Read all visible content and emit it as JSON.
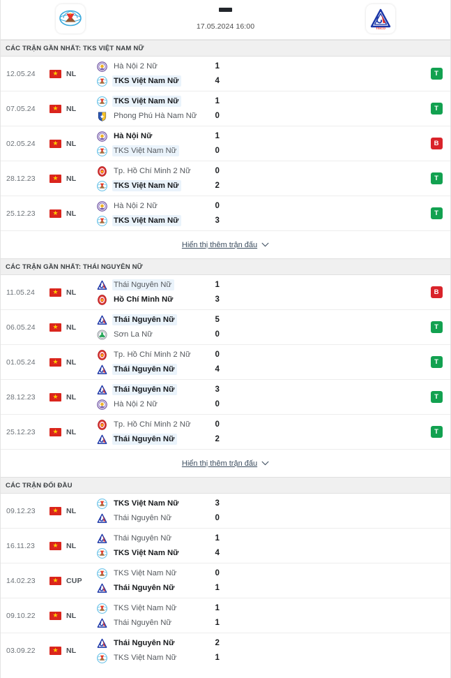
{
  "header": {
    "home_team": "TKS Việt Nam Nữ",
    "away_team": "Thái Nguyên Nữ",
    "home_logo": "vff-crest-icon",
    "away_logo": "tisco-triangle-icon",
    "score_separator": "-",
    "kickoff": "17.05.2024 16:00"
  },
  "colors": {
    "win": "#12a150",
    "loss": "#d9232a",
    "highlight": "#eaf3fb",
    "section_bg": "#f0f0f0",
    "flag_red": "#da251d",
    "flag_star": "#ffcd00"
  },
  "sections": [
    {
      "title": "CÁC TRẬN GẦN NHẤT: TKS VIỆT NAM NỮ",
      "show_more_label": "Hiển thị thêm trận đấu",
      "has_show_more": true,
      "matches": [
        {
          "date": "12.05.24",
          "competition": "NL",
          "flag": "vietnam-flag-icon",
          "home": {
            "name": "Hà Nội 2 Nữ",
            "logo": "ha-noi-crest-icon",
            "bold": false,
            "highlight": false,
            "score": "1"
          },
          "away": {
            "name": "TKS Việt Nam Nữ",
            "logo": "tks-crest-icon",
            "bold": true,
            "highlight": true,
            "score": "4"
          },
          "result": "T",
          "result_type": "win"
        },
        {
          "date": "07.05.24",
          "competition": "NL",
          "flag": "vietnam-flag-icon",
          "home": {
            "name": "TKS Việt Nam Nữ",
            "logo": "tks-crest-icon",
            "bold": true,
            "highlight": true,
            "score": "1"
          },
          "away": {
            "name": "Phong Phú Hà Nam Nữ",
            "logo": "phong-phu-ha-nam-crest-icon",
            "bold": false,
            "highlight": false,
            "score": "0"
          },
          "result": "T",
          "result_type": "win"
        },
        {
          "date": "02.05.24",
          "competition": "NL",
          "flag": "vietnam-flag-icon",
          "home": {
            "name": "Hà Nội Nữ",
            "logo": "ha-noi-crest-icon",
            "bold": true,
            "highlight": false,
            "score": "1"
          },
          "away": {
            "name": "TKS Việt Nam Nữ",
            "logo": "tks-crest-icon",
            "bold": false,
            "highlight": true,
            "score": "0"
          },
          "result": "B",
          "result_type": "loss"
        },
        {
          "date": "28.12.23",
          "competition": "NL",
          "flag": "vietnam-flag-icon",
          "home": {
            "name": "Tp. Hồ Chí Minh 2 Nữ",
            "logo": "ho-chi-minh-crest-icon",
            "bold": false,
            "highlight": false,
            "score": "0"
          },
          "away": {
            "name": "TKS Việt Nam Nữ",
            "logo": "tks-crest-icon",
            "bold": true,
            "highlight": true,
            "score": "2"
          },
          "result": "T",
          "result_type": "win"
        },
        {
          "date": "25.12.23",
          "competition": "NL",
          "flag": "vietnam-flag-icon",
          "home": {
            "name": "Hà Nội 2 Nữ",
            "logo": "ha-noi-crest-icon",
            "bold": false,
            "highlight": false,
            "score": "0"
          },
          "away": {
            "name": "TKS Việt Nam Nữ",
            "logo": "tks-crest-icon",
            "bold": true,
            "highlight": true,
            "score": "3"
          },
          "result": "T",
          "result_type": "win"
        }
      ]
    },
    {
      "title": "CÁC TRẬN GẦN NHẤT: THÁI NGUYÊN NỮ",
      "show_more_label": "Hiển thị thêm trận đấu",
      "has_show_more": true,
      "matches": [
        {
          "date": "11.05.24",
          "competition": "NL",
          "flag": "vietnam-flag-icon",
          "home": {
            "name": "Thái Nguyên Nữ",
            "logo": "thai-nguyen-crest-icon",
            "bold": false,
            "highlight": true,
            "score": "1"
          },
          "away": {
            "name": "Hồ Chí Minh Nữ",
            "logo": "ho-chi-minh-crest-icon",
            "bold": true,
            "highlight": false,
            "score": "3"
          },
          "result": "B",
          "result_type": "loss"
        },
        {
          "date": "06.05.24",
          "competition": "NL",
          "flag": "vietnam-flag-icon",
          "home": {
            "name": "Thái Nguyên Nữ",
            "logo": "thai-nguyen-crest-icon",
            "bold": true,
            "highlight": true,
            "score": "5"
          },
          "away": {
            "name": "Sơn La Nữ",
            "logo": "son-la-crest-icon",
            "bold": false,
            "highlight": false,
            "score": "0"
          },
          "result": "T",
          "result_type": "win"
        },
        {
          "date": "01.05.24",
          "competition": "NL",
          "flag": "vietnam-flag-icon",
          "home": {
            "name": "Tp. Hồ Chí Minh 2 Nữ",
            "logo": "ho-chi-minh-crest-icon",
            "bold": false,
            "highlight": false,
            "score": "0"
          },
          "away": {
            "name": "Thái Nguyên Nữ",
            "logo": "thai-nguyen-crest-icon",
            "bold": true,
            "highlight": true,
            "score": "4"
          },
          "result": "T",
          "result_type": "win"
        },
        {
          "date": "28.12.23",
          "competition": "NL",
          "flag": "vietnam-flag-icon",
          "home": {
            "name": "Thái Nguyên Nữ",
            "logo": "thai-nguyen-crest-icon",
            "bold": true,
            "highlight": true,
            "score": "3"
          },
          "away": {
            "name": "Hà Nội 2 Nữ",
            "logo": "ha-noi-crest-icon",
            "bold": false,
            "highlight": false,
            "score": "0"
          },
          "result": "T",
          "result_type": "win"
        },
        {
          "date": "25.12.23",
          "competition": "NL",
          "flag": "vietnam-flag-icon",
          "home": {
            "name": "Tp. Hồ Chí Minh 2 Nữ",
            "logo": "ho-chi-minh-crest-icon",
            "bold": false,
            "highlight": false,
            "score": "0"
          },
          "away": {
            "name": "Thái Nguyên Nữ",
            "logo": "thai-nguyen-crest-icon",
            "bold": true,
            "highlight": true,
            "score": "2"
          },
          "result": "T",
          "result_type": "win"
        }
      ]
    },
    {
      "title": "CÁC TRẬN ĐỐI ĐẦU",
      "show_more_label": "",
      "has_show_more": false,
      "matches": [
        {
          "date": "09.12.23",
          "competition": "NL",
          "flag": "vietnam-flag-icon",
          "home": {
            "name": "TKS Việt Nam Nữ",
            "logo": "tks-crest-icon",
            "bold": true,
            "highlight": false,
            "score": "3"
          },
          "away": {
            "name": "Thái Nguyên Nữ",
            "logo": "thai-nguyen-crest-icon",
            "bold": false,
            "highlight": false,
            "score": "0"
          },
          "result": "",
          "result_type": "empty"
        },
        {
          "date": "16.11.23",
          "competition": "NL",
          "flag": "vietnam-flag-icon",
          "home": {
            "name": "Thái Nguyên Nữ",
            "logo": "thai-nguyen-crest-icon",
            "bold": false,
            "highlight": false,
            "score": "1"
          },
          "away": {
            "name": "TKS Việt Nam Nữ",
            "logo": "tks-crest-icon",
            "bold": true,
            "highlight": false,
            "score": "4"
          },
          "result": "",
          "result_type": "empty"
        },
        {
          "date": "14.02.23",
          "competition": "CUP",
          "flag": "vietnam-flag-icon",
          "home": {
            "name": "TKS Việt Nam Nữ",
            "logo": "tks-crest-icon",
            "bold": false,
            "highlight": false,
            "score": "0"
          },
          "away": {
            "name": "Thái Nguyên Nữ",
            "logo": "thai-nguyen-crest-icon",
            "bold": true,
            "highlight": false,
            "score": "1"
          },
          "result": "",
          "result_type": "empty"
        },
        {
          "date": "09.10.22",
          "competition": "NL",
          "flag": "vietnam-flag-icon",
          "home": {
            "name": "TKS Việt Nam Nữ",
            "logo": "tks-crest-icon",
            "bold": false,
            "highlight": false,
            "score": "1"
          },
          "away": {
            "name": "Thái Nguyên Nữ",
            "logo": "thai-nguyen-crest-icon",
            "bold": false,
            "highlight": false,
            "score": "1"
          },
          "result": "",
          "result_type": "empty"
        },
        {
          "date": "03.09.22",
          "competition": "NL",
          "flag": "vietnam-flag-icon",
          "home": {
            "name": "Thái Nguyên Nữ",
            "logo": "thai-nguyen-crest-icon",
            "bold": true,
            "highlight": false,
            "score": "2"
          },
          "away": {
            "name": "TKS Việt Nam Nữ",
            "logo": "tks-crest-icon",
            "bold": false,
            "highlight": false,
            "score": "1"
          },
          "result": "",
          "result_type": "empty"
        }
      ]
    }
  ]
}
